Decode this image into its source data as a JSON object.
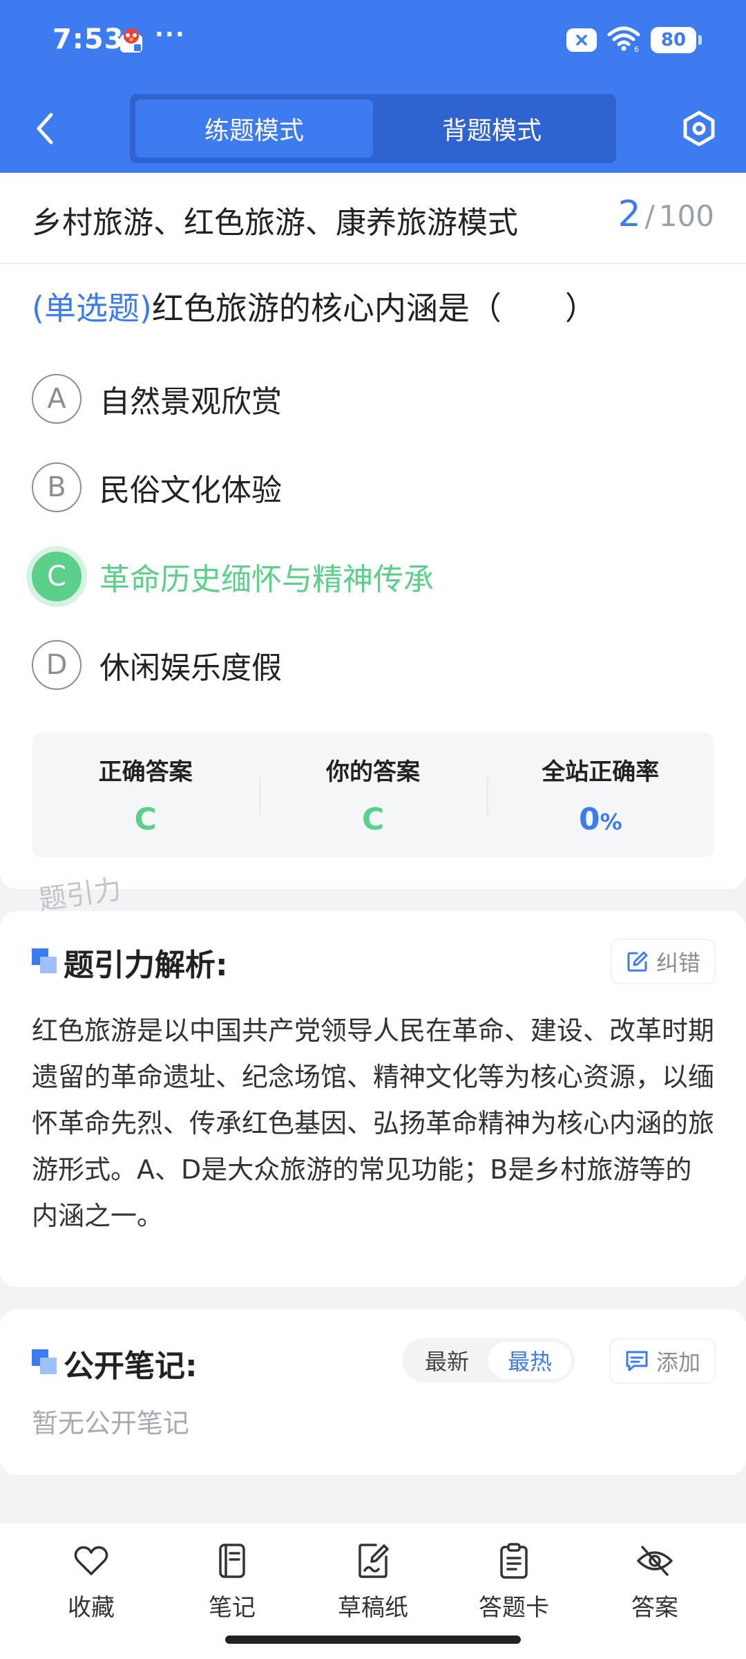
{
  "status_bar": {
    "time": "7:53",
    "more": "···",
    "battery": "80"
  },
  "header": {
    "tabs": [
      {
        "label": "练题模式",
        "active": true
      },
      {
        "label": "背题模式",
        "active": false
      }
    ]
  },
  "question_card": {
    "chapter": "乡村旅游、红色旅游、康养旅游模式",
    "progress": {
      "current": "2",
      "separator": "/",
      "total": "100"
    },
    "question_type": "(单选题)",
    "question_text": "红色旅游的核心内涵是（　　）",
    "options": [
      {
        "letter": "A",
        "text": "自然景观欣赏",
        "state": "normal"
      },
      {
        "letter": "B",
        "text": "民俗文化体验",
        "state": "normal"
      },
      {
        "letter": "C",
        "text": "革命历史缅怀与精神传承",
        "state": "correct"
      },
      {
        "letter": "D",
        "text": "休闲娱乐度假",
        "state": "normal"
      }
    ],
    "answer_summary": {
      "correct_label": "正确答案",
      "correct_value": "C",
      "yours_label": "你的答案",
      "yours_value": "C",
      "rate_label": "全站正确率",
      "rate_value": "0",
      "rate_unit": "%"
    }
  },
  "watermark": "题引力",
  "analysis": {
    "title": "题引力解析:",
    "report_label": "纠错",
    "text": "红色旅游是以中国共产党领导人民在革命、建设、改革时期遗留的革命遗址、纪念场馆、精神文化等为核心资源，以缅怀革命先烈、传承红色基因、弘扬革命精神为核心内涵的旅游形式。A、D是大众旅游的常见功能；B是乡村旅游等的内涵之一。"
  },
  "notes": {
    "title": "公开笔记:",
    "sort_options": [
      {
        "label": "最新",
        "active": false
      },
      {
        "label": "最热",
        "active": true
      }
    ],
    "add_label": "添加",
    "empty_text": "暂无公开笔记"
  },
  "bottom_bar": {
    "items": [
      {
        "label": "收藏",
        "icon": "heart-icon"
      },
      {
        "label": "笔记",
        "icon": "notebook-icon"
      },
      {
        "label": "草稿纸",
        "icon": "draft-icon"
      },
      {
        "label": "答题卡",
        "icon": "clipboard-icon"
      },
      {
        "label": "答案",
        "icon": "eye-off-icon"
      }
    ]
  },
  "colors": {
    "primary": "#3d7bf0",
    "correct": "#5ccf8a",
    "muted": "#8a8f96"
  }
}
